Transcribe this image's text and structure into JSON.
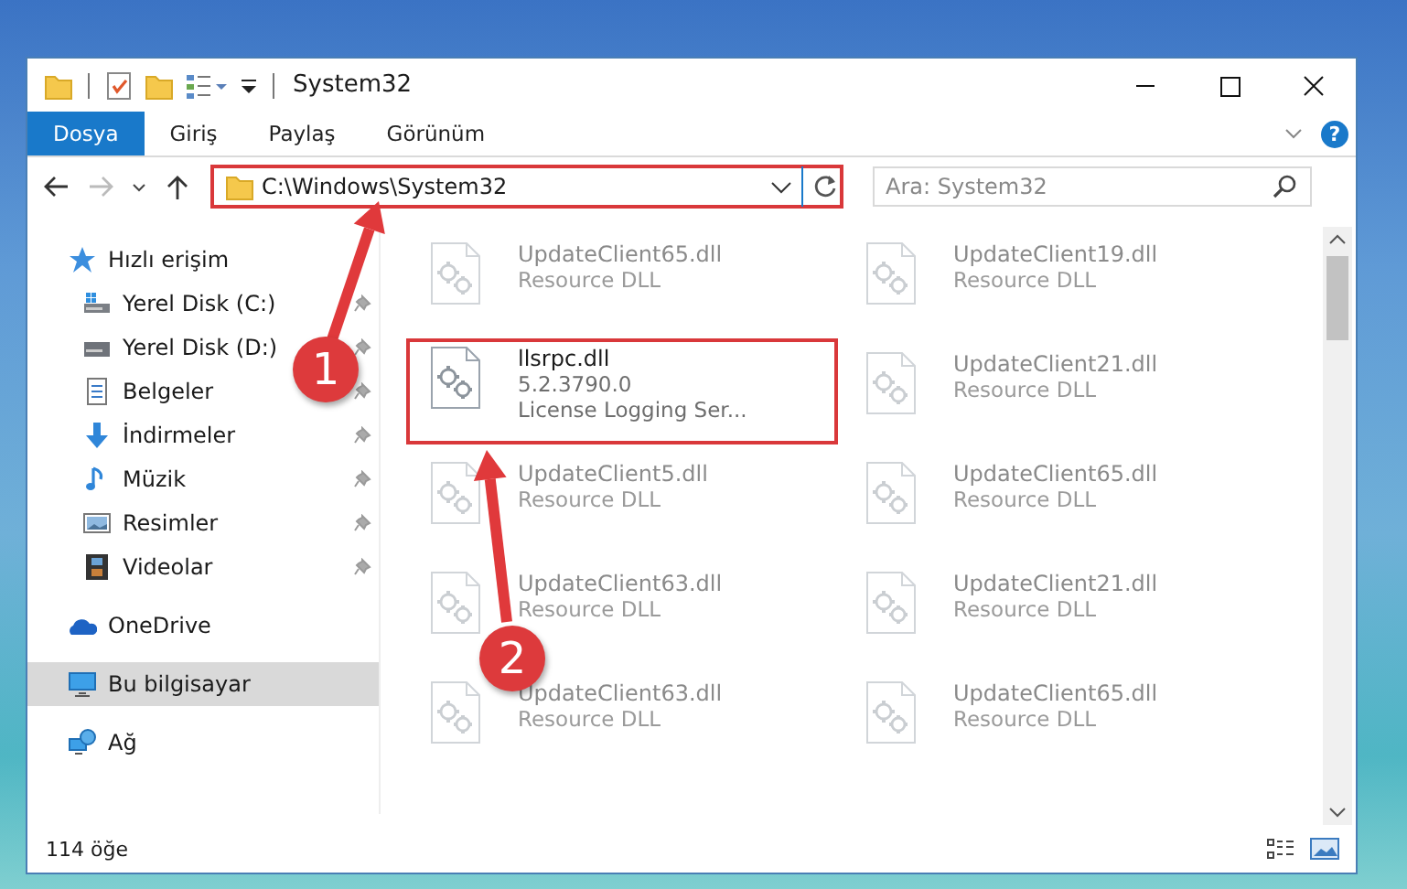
{
  "window": {
    "title": "System32"
  },
  "ribbon": {
    "tabs": [
      {
        "label": "Dosya",
        "selected": true
      },
      {
        "label": "Giriş",
        "selected": false
      },
      {
        "label": "Paylaş",
        "selected": false
      },
      {
        "label": "Görünüm",
        "selected": false
      }
    ],
    "help": "?"
  },
  "navigation": {
    "forward_disabled": true
  },
  "address": {
    "path": "C:\\Windows\\System32",
    "highlighted": true
  },
  "search": {
    "placeholder": "Ara: System32"
  },
  "sidebar": {
    "items": [
      {
        "label": "Hızlı erişim",
        "selected": false,
        "children": [
          {
            "label": "Yerel Disk (C:)",
            "pinned": true
          },
          {
            "label": "Yerel Disk (D:)",
            "pinned": true
          },
          {
            "label": "Belgeler",
            "pinned": true
          },
          {
            "label": "İndirmeler",
            "pinned": true
          },
          {
            "label": "Müzik",
            "pinned": true
          },
          {
            "label": "Resimler",
            "pinned": true
          },
          {
            "label": "Videolar",
            "pinned": true
          }
        ]
      },
      {
        "label": "OneDrive",
        "selected": false
      },
      {
        "label": "Bu bilgisayar",
        "selected": true
      },
      {
        "label": "Ağ",
        "selected": false
      }
    ]
  },
  "files": [
    {
      "name": "UpdateClient65.dll",
      "lines": [
        "Resource DLL"
      ],
      "faded": true,
      "highlighted": false
    },
    {
      "name": "UpdateClient19.dll",
      "lines": [
        "Resource DLL"
      ],
      "faded": true,
      "highlighted": false
    },
    {
      "name": "llsrpc.dll",
      "lines": [
        "5.2.3790.0",
        "License Logging Ser..."
      ],
      "faded": false,
      "highlighted": true
    },
    {
      "name": "UpdateClient21.dll",
      "lines": [
        "Resource DLL"
      ],
      "faded": true,
      "highlighted": false
    },
    {
      "name": "UpdateClient5.dll",
      "lines": [
        "Resource DLL"
      ],
      "faded": true,
      "highlighted": false
    },
    {
      "name": "UpdateClient65.dll",
      "lines": [
        "Resource DLL"
      ],
      "faded": true,
      "highlighted": false
    },
    {
      "name": "UpdateClient63.dll",
      "lines": [
        "Resource DLL"
      ],
      "faded": true,
      "highlighted": false
    },
    {
      "name": "UpdateClient21.dll",
      "lines": [
        "Resource DLL"
      ],
      "faded": true,
      "highlighted": false
    },
    {
      "name": "UpdateClient63.dll",
      "lines": [
        "Resource DLL"
      ],
      "faded": true,
      "highlighted": false
    },
    {
      "name": "UpdateClient65.dll",
      "lines": [
        "Resource DLL"
      ],
      "faded": true,
      "highlighted": false
    }
  ],
  "status_bar": {
    "count": "114 öğe"
  },
  "annotations": [
    {
      "label": "1"
    },
    {
      "label": "2"
    }
  ]
}
